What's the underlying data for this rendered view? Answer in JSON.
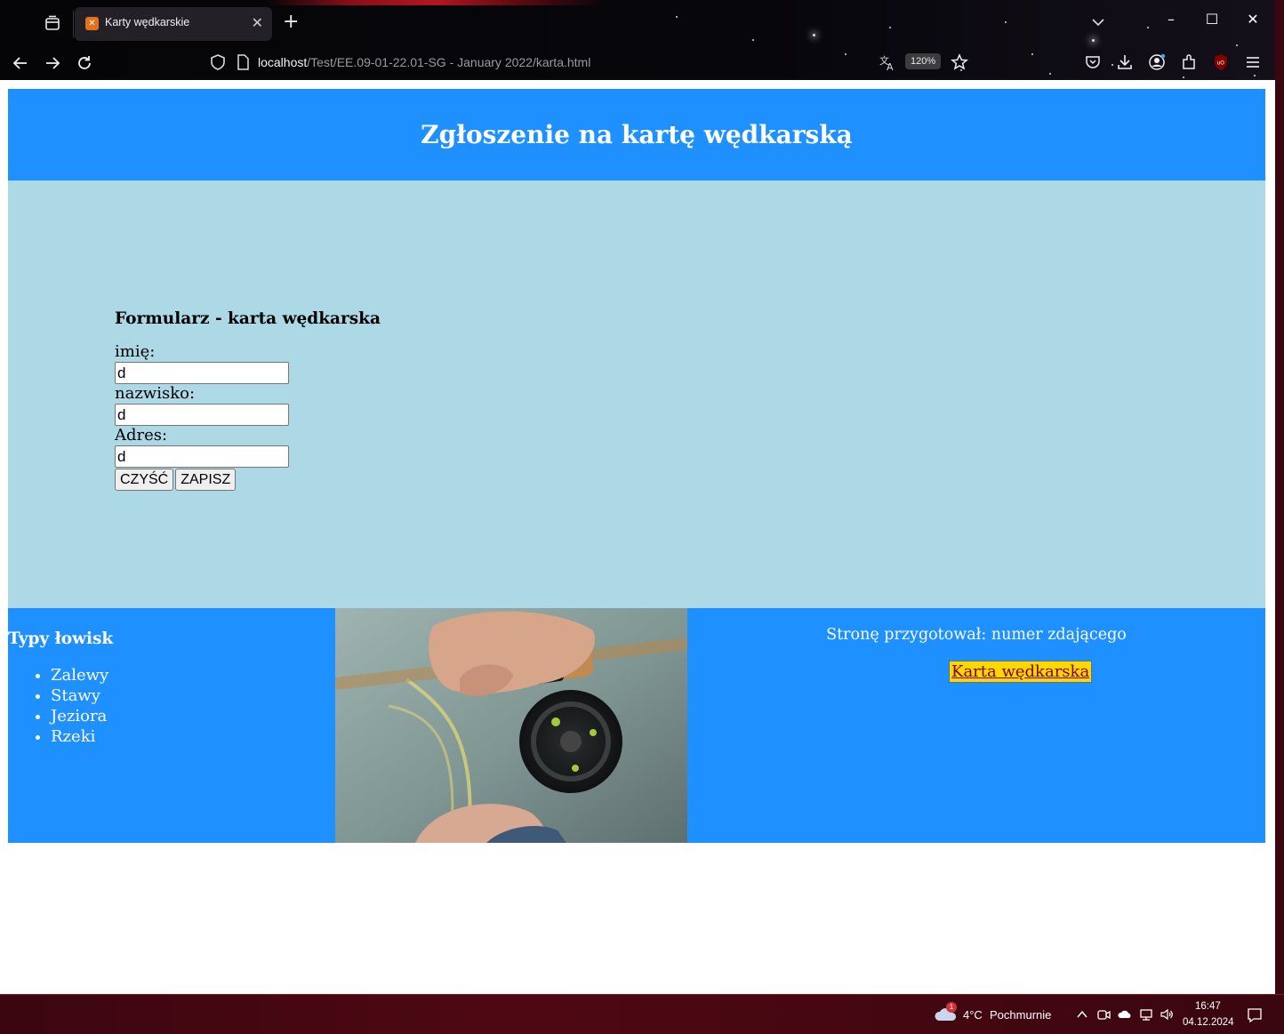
{
  "browser": {
    "tab_title": "Karty wędkarskie",
    "url_host": "localhost",
    "url_path": "/Test/EE.09-01-22.01-SG - January 2022/karta.html",
    "zoom": "120%"
  },
  "page": {
    "header_title": "Zgłoszenie na kartę wędkarską",
    "form": {
      "heading": "Formularz - karta wędkarska",
      "first_name_label": "imię:",
      "first_name_value": "d",
      "last_name_label": "nazwisko:",
      "last_name_value": "d",
      "address_label": "Adres:",
      "address_value": "d",
      "clear_button": "CZYŚĆ",
      "save_button": "ZAPISZ"
    },
    "footer_left": {
      "heading": "Typy łowisk",
      "items": [
        "Zalewy",
        "Stawy",
        "Jeziora",
        "Rzeki"
      ]
    },
    "footer_right": {
      "author_text": "Stronę przygotował: numer zdającego",
      "link_text": "Karta wędkarska"
    },
    "colors": {
      "header_bg": "#1e90ff",
      "main_bg": "#add8e6",
      "link_bg": "#ffd700",
      "link_color": "#800020"
    }
  },
  "taskbar": {
    "weather_badge": "1",
    "temperature": "4°C",
    "condition": "Pochmurnie",
    "time": "16:47",
    "date": "04.12.2024"
  }
}
